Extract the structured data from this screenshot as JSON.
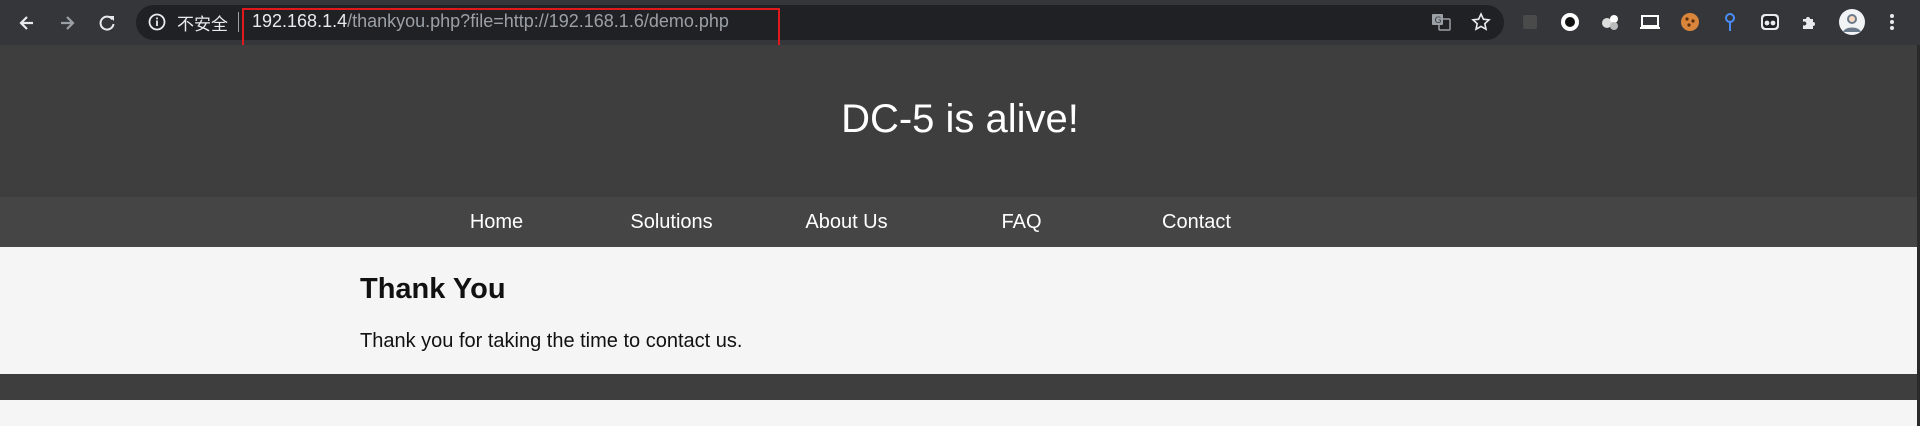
{
  "browser": {
    "security_label": "不安全",
    "url_host": "192.168.1.4",
    "url_path": "/thankyou.php?file=http://192.168.1.6/demo.php",
    "highlight_color": "#e0191c",
    "icons": [
      "back-icon",
      "forward-icon",
      "reload-icon",
      "info-icon",
      "translate-icon",
      "bookmark-star-icon",
      "extension-icons",
      "puzzle-icon",
      "profile-avatar",
      "menu-dots-icon"
    ]
  },
  "site": {
    "title": "DC-5 is alive!",
    "nav": [
      "Home",
      "Solutions",
      "About Us",
      "FAQ",
      "Contact"
    ]
  },
  "page": {
    "heading": "Thank You",
    "message": "Thank you for taking the time to contact us."
  },
  "colors": {
    "header_bg": "#3e3e3e",
    "nav_bg": "#454545",
    "content_bg": "#f5f5f5"
  }
}
